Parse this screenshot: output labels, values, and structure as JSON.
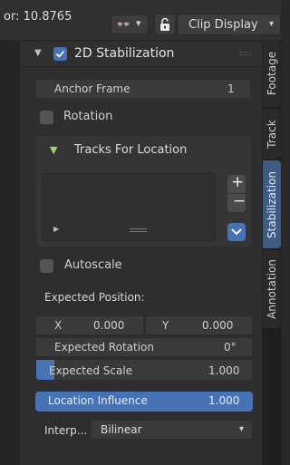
{
  "header": {
    "factor_text": "or: 10.8765",
    "clip_display_label": "Clip Display"
  },
  "panel": {
    "title": "2D Stabilization",
    "enabled": true,
    "anchor_frame": {
      "label": "Anchor Frame",
      "value": "1"
    },
    "rotation": {
      "label": "Rotation",
      "checked": false
    },
    "tracks_for_location": {
      "title": "Tracks For Location"
    },
    "autoscale": {
      "label": "Autoscale",
      "checked": false
    },
    "expected_position": {
      "label": "Expected Position:",
      "x_label": "X",
      "x_value": "0.000",
      "y_label": "Y",
      "y_value": "0.000"
    },
    "expected_rotation": {
      "label": "Expected Rotation",
      "value": "0°"
    },
    "expected_scale": {
      "label": "Expected Scale",
      "value": "1.000"
    },
    "location_influence": {
      "label": "Location Influence",
      "value": "1.000"
    },
    "interpolate": {
      "label": "Interp...",
      "value": "Bilinear"
    }
  },
  "tabs": [
    {
      "label": "Footage",
      "active": false
    },
    {
      "label": "Track",
      "active": false
    },
    {
      "label": "Stabilization",
      "active": true
    },
    {
      "label": "Annotation",
      "active": false
    }
  ],
  "colors": {
    "accent": "#4772b3",
    "panel_bg": "#2e2e2e",
    "tracks_arrow": "#9fd37a",
    "view_toggle_icon": "#e89a3a"
  },
  "icons": {
    "view_toggle": "glasses-icon",
    "lock": "lock-icon",
    "collapse": "triangle-down-icon",
    "tracks_header": "triangle-down-icon",
    "add": "plus-icon",
    "remove": "minus-icon",
    "menu": "chevron-down-icon",
    "play": "play-icon"
  }
}
